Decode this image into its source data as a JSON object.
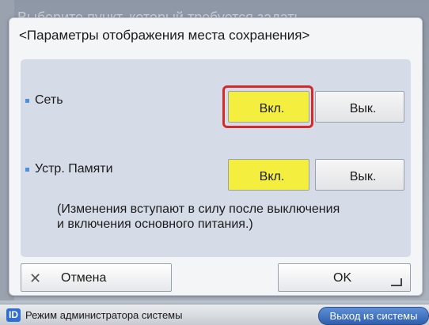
{
  "background": {
    "title": "Выберите пункт, который требуется задать."
  },
  "dialog": {
    "title": "<Параметры отображения места сохранения>",
    "rows": [
      {
        "label": "Сеть",
        "on_label": "Вкл.",
        "off_label": "Вык.",
        "selected": "on",
        "focused": true
      },
      {
        "label": "Устр. Памяти",
        "on_label": "Вкл.",
        "off_label": "Вык.",
        "selected": "on",
        "focused": false
      }
    ],
    "note_line1": "(Изменения вступают в силу после выключения",
    "note_line2": "и включения основного питания.)",
    "cancel_label": "Отмена",
    "ok_label": "OK"
  },
  "statusbar": {
    "id_icon": "ID",
    "mode_label": "Режим администратора системы",
    "logout_label": "Выход из системы"
  },
  "colors": {
    "selected": "#f4ee3e",
    "focus": "#d42a2a",
    "accent": "#2f6fd1"
  }
}
